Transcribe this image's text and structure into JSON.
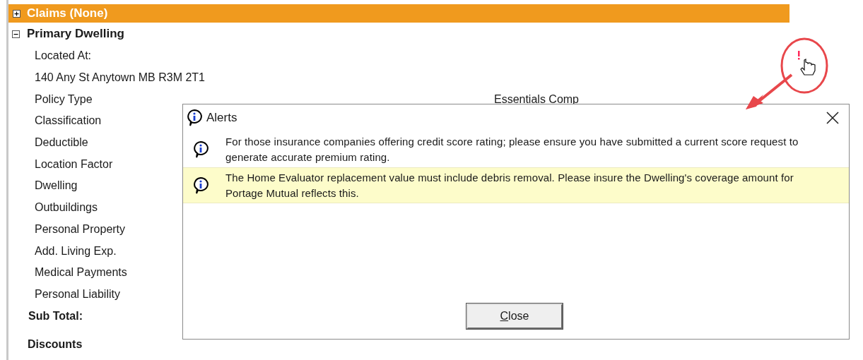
{
  "claims_bar": {
    "label": "Claims (None)",
    "expanded": false
  },
  "section": {
    "title": "Primary Dwelling",
    "expanded": true,
    "fields": [
      {
        "label": "Located At:"
      },
      {
        "label": "140 Any St Anytown MB R3M 2T1"
      },
      {
        "label": "Policy Type",
        "value": "Essentials Comp"
      },
      {
        "label": "Classification"
      },
      {
        "label": "Deductible"
      },
      {
        "label": "Location Factor"
      },
      {
        "label": "Dwelling"
      },
      {
        "label": "Outbuildings"
      },
      {
        "label": "Personal Property"
      },
      {
        "label": "Add. Living Exp."
      },
      {
        "label": "Medical Payments"
      },
      {
        "label": "Personal Liability"
      }
    ],
    "subtotal": "Sub Total:",
    "next_heading": "Discounts"
  },
  "dialog": {
    "title": "Alerts",
    "close_button": "Close",
    "alerts": [
      {
        "text": "For those insurance companies offering credit score rating; please ensure you have submitted a current score request to generate accurate premium rating.",
        "selected": false
      },
      {
        "text": "The Home Evaluator replacement value must include debris removal.  Please insure the Dwelling's coverage amount for Portage Mutual reflects this.",
        "selected": true
      }
    ]
  }
}
